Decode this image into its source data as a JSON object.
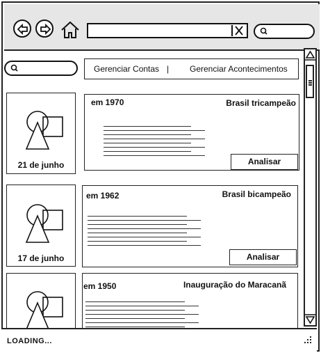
{
  "address_bar": {
    "value": ""
  },
  "top_search": {
    "value": ""
  },
  "side_search": {
    "value": ""
  },
  "menu": {
    "items": [
      "Gerenciar Contas",
      "Gerenciar Acontecimentos"
    ],
    "separator": "|"
  },
  "events": [
    {
      "date": "21 de junho",
      "year": "em 1970",
      "title": "Brasil tricampeão",
      "action": "Analisar"
    },
    {
      "date": "17 de junho",
      "year": "em 1962",
      "title": "Brasil bicampeão",
      "action": "Analisar"
    },
    {
      "date": "",
      "year": "em 1950",
      "title": "Inauguração do Maracanã",
      "action": ""
    }
  ],
  "status": {
    "text": "LOADING..."
  },
  "icons": [
    "back-icon",
    "forward-icon",
    "home-icon",
    "clear-icon",
    "search-icon",
    "image-placeholder-icon",
    "resize-grip-icon"
  ]
}
